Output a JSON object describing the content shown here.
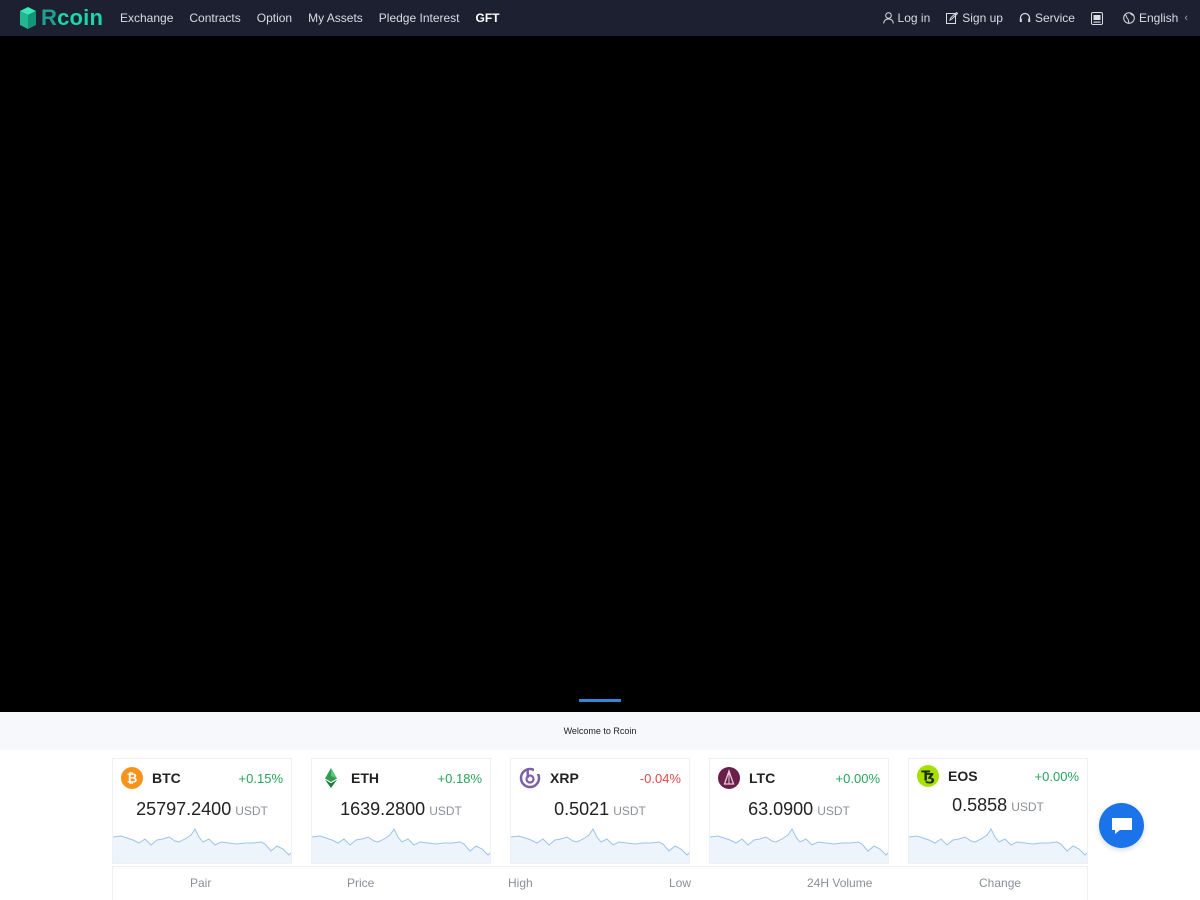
{
  "brand": {
    "r": "R",
    "coin": "coin",
    "accent": "#1fd4a6"
  },
  "nav": {
    "links": [
      "Exchange",
      "Contracts",
      "Option",
      "My Assets",
      "Pledge Interest",
      "GFT"
    ],
    "login": "Log in",
    "signup": "Sign up",
    "service": "Service",
    "language": "English"
  },
  "welcome": "Welcome to Rcoin",
  "markets": [
    {
      "symbol": "BTC",
      "change": "+0.15%",
      "price": "25797.2400",
      "unit": "USDT",
      "direction": "up",
      "icon": "bitcoin-icon",
      "icon_color": "#f7931a"
    },
    {
      "symbol": "ETH",
      "change": "+0.18%",
      "price": "1639.2800",
      "unit": "USDT",
      "direction": "up",
      "icon": "ethereum-icon",
      "icon_color": "#2f9e4f"
    },
    {
      "symbol": "XRP",
      "change": "-0.04%",
      "price": "0.5021",
      "unit": "USDT",
      "direction": "down",
      "icon": "xrp-icon",
      "icon_color": "#7b5ea7"
    },
    {
      "symbol": "LTC",
      "change": "+0.00%",
      "price": "63.0900",
      "unit": "USDT",
      "direction": "up",
      "icon": "litecoin-icon",
      "icon_color": "#6a1f4a"
    },
    {
      "symbol": "EOS",
      "change": "+0.00%",
      "price": "0.5858",
      "unit": "USDT",
      "direction": "up",
      "icon": "tezos-icon",
      "icon_color": "#a6e000"
    }
  ],
  "table_headers": [
    "Pair",
    "Price",
    "High",
    "Low",
    "24H Volume",
    "Change"
  ],
  "colors": {
    "up": "#27a35a",
    "down": "#e04848",
    "nav_bg": "#1c2030",
    "hero_bg": "#000000",
    "chat": "#1a73e8"
  }
}
